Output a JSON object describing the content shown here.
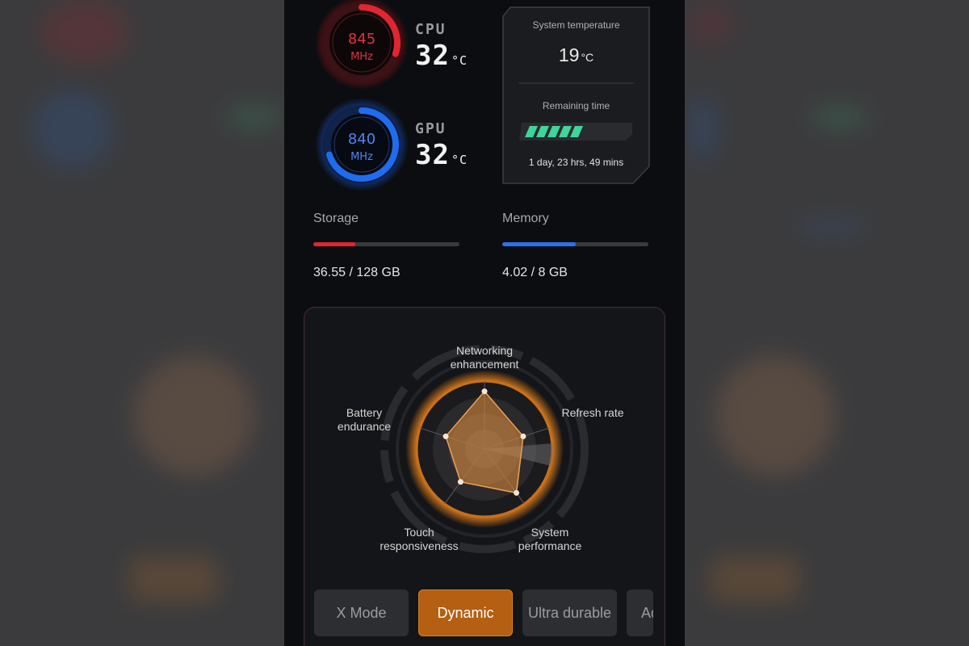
{
  "colors": {
    "cpu_accent": "#e0262f",
    "gpu_accent": "#1e6df0",
    "orange_accent": "#b45f12",
    "battery_green": "#3ed69a",
    "screen_bg": "#0c0d10"
  },
  "cpu": {
    "frequency": "845",
    "frequency_unit": "MHz",
    "name": "CPU",
    "temperature": "32",
    "temperature_unit": "°C",
    "load_fraction": 0.3
  },
  "gpu": {
    "frequency": "840",
    "frequency_unit": "MHz",
    "name": "GPU",
    "temperature": "32",
    "temperature_unit": "°C",
    "load_fraction": 0.7
  },
  "system": {
    "temperature_label": "System temperature",
    "temperature_value": "19",
    "temperature_unit": "°C",
    "remaining_label": "Remaining time",
    "remaining_value": "1 day, 23 hrs, 49 mins",
    "battery_fraction": 0.55
  },
  "storage": {
    "label": "Storage",
    "value": "36.55 / 128 GB",
    "fraction": 0.2855
  },
  "memory": {
    "label": "Memory",
    "value": "4.02 / 8 GB",
    "fraction": 0.5025
  },
  "radar": {
    "axes": [
      {
        "label_line1": "Networking",
        "label_line2": "enhancement"
      },
      {
        "label_line1": "Refresh rate",
        "label_line2": ""
      },
      {
        "label_line1": "System",
        "label_line2": "performance"
      },
      {
        "label_line1": "Touch",
        "label_line2": "responsiveness"
      },
      {
        "label_line1": "Battery",
        "label_line2": "endurance"
      }
    ]
  },
  "modes": {
    "x_mode": "X Mode",
    "dynamic": "Dynamic",
    "ultra_durable": "Ultra durable",
    "advanced": "Ad",
    "selected": "Dynamic"
  }
}
